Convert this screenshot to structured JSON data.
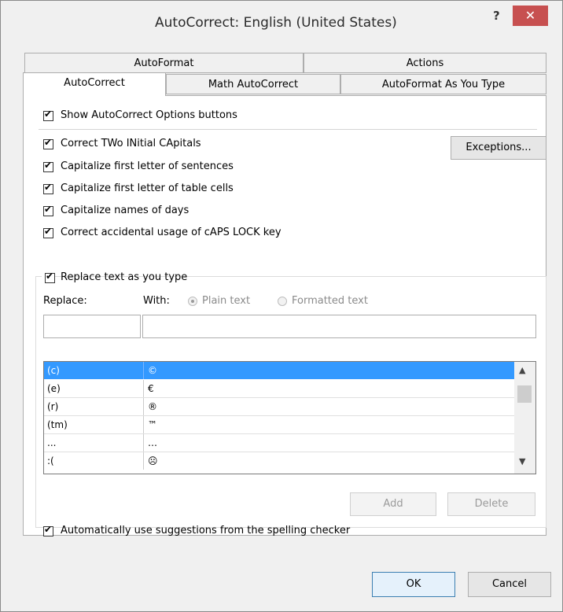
{
  "window": {
    "title": "AutoCorrect: English (United States)",
    "help_label": "?",
    "close_label": "✕"
  },
  "tabs": {
    "row1": [
      "AutoFormat",
      "Actions"
    ],
    "row2": [
      "AutoCorrect",
      "Math AutoCorrect",
      "AutoFormat As You Type"
    ],
    "active": "AutoCorrect"
  },
  "options": {
    "show_buttons": "Show AutoCorrect Options buttons",
    "two_initial_caps": "Correct TWo INitial CApitals",
    "first_letter_sentences": "Capitalize first letter of sentences",
    "first_letter_cells": "Capitalize first letter of table cells",
    "names_of_days": "Capitalize names of days",
    "caps_lock": "Correct accidental usage of cAPS LOCK key",
    "exceptions_label": "Exceptions..."
  },
  "replace": {
    "group_label": "Replace text as you type",
    "replace_label": "Replace:",
    "with_label": "With:",
    "plain_text": "Plain text",
    "formatted_text": "Formatted text",
    "replace_value": "",
    "with_value": "",
    "selected_format": "Plain text"
  },
  "entries": [
    {
      "replace": "(c)",
      "with": "©"
    },
    {
      "replace": "(e)",
      "with": "€"
    },
    {
      "replace": "(r)",
      "with": "®"
    },
    {
      "replace": "(tm)",
      "with": "™"
    },
    {
      "replace": "...",
      "with": "…"
    },
    {
      "replace": ":(",
      "with": "☹"
    }
  ],
  "selected_entry": 0,
  "buttons": {
    "add": "Add",
    "delete": "Delete",
    "ok": "OK",
    "cancel": "Cancel"
  },
  "spelling": "Automatically use suggestions from the spelling checker",
  "colors": {
    "selection": "#3399ff",
    "close": "#c75050"
  }
}
